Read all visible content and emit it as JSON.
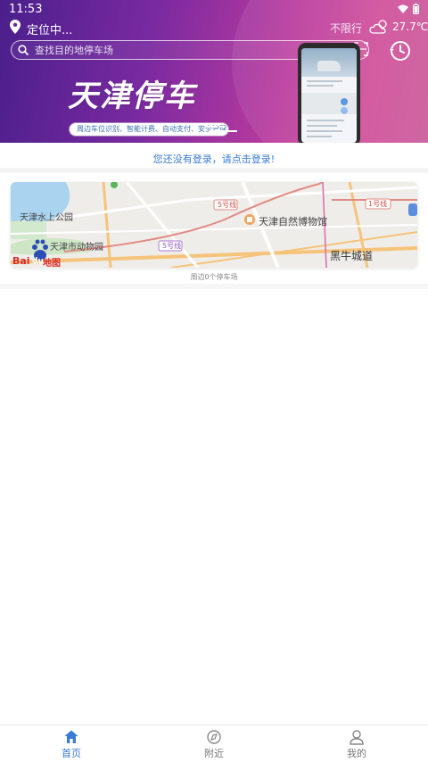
{
  "status_bar": {
    "time": "11:53"
  },
  "header": {
    "location": "定位中...",
    "limit": "不限行",
    "weather_icon": "cloud-sun-icon",
    "temperature": "27.7℃",
    "search_placeholder": "查找目的地停车场",
    "banner_title": "天津停车",
    "banner_tagline": "周边车位识别、智能计费、自动支付、安全管理"
  },
  "login_notice": "您还没有登录，请点击登录!",
  "map": {
    "labels": {
      "water_park": "天津水上公园",
      "zoo": "天津市动物园",
      "museum": "天津自然博物馆",
      "line5_a": "5号线",
      "line5_b": "5号线",
      "line1": "1号线",
      "heiniu": "黑牛城道",
      "logo_bai": "Bai",
      "logo_du": "du",
      "logo_ditu": "地图"
    },
    "nearby": "周边0个停车场"
  },
  "bottom_nav": [
    {
      "label": "首页",
      "icon": "home-icon",
      "active": true
    },
    {
      "label": "附近",
      "icon": "nearby-icon",
      "active": false
    },
    {
      "label": "我的",
      "icon": "user-icon",
      "active": false
    }
  ],
  "colors": {
    "accent": "#3a7bd5",
    "banner_start": "#4a1f8c",
    "banner_end": "#d14f9a"
  }
}
